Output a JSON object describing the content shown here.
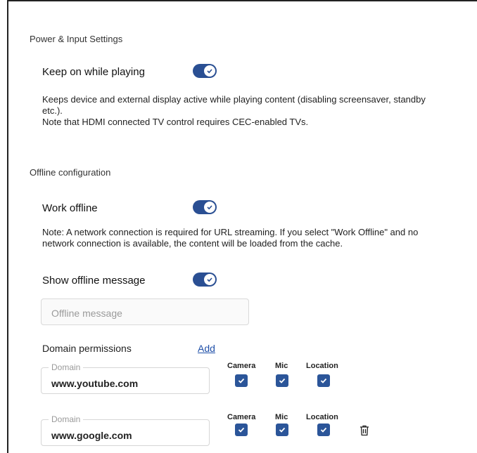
{
  "power": {
    "section_title": "Power & Input Settings",
    "keep_on_label": "Keep on while playing",
    "keep_on_enabled": true,
    "desc_line1": "Keeps device and external display active while playing content (disabling screensaver, standby",
    "desc_line2": "etc.).",
    "desc_line3": "Note that HDMI connected TV control requires CEC-enabled TVs."
  },
  "offline": {
    "section_title": "Offline configuration",
    "work_offline_label": "Work offline",
    "work_offline_enabled": true,
    "note_line1": "Note: A network connection is required for URL streaming. If you select \"Work Offline\" and no",
    "note_line2": "network connection is available, the content will be loaded from the cache.",
    "show_message_label": "Show offline message",
    "show_message_enabled": true,
    "message_placeholder": "Offline message"
  },
  "domains": {
    "title": "Domain permissions",
    "add_label": "Add",
    "field_label": "Domain",
    "columns": [
      "Camera",
      "Mic",
      "Location"
    ],
    "rows": [
      {
        "domain": "www.youtube.com",
        "camera": true,
        "mic": true,
        "location": true
      },
      {
        "domain": "www.google.com",
        "camera": true,
        "mic": true,
        "location": true
      }
    ]
  },
  "colors": {
    "accent": "#2a4f93",
    "checkbox": "#2b5599",
    "link": "#1f4fa8"
  },
  "icons": [
    "check-icon",
    "trash-icon"
  ]
}
